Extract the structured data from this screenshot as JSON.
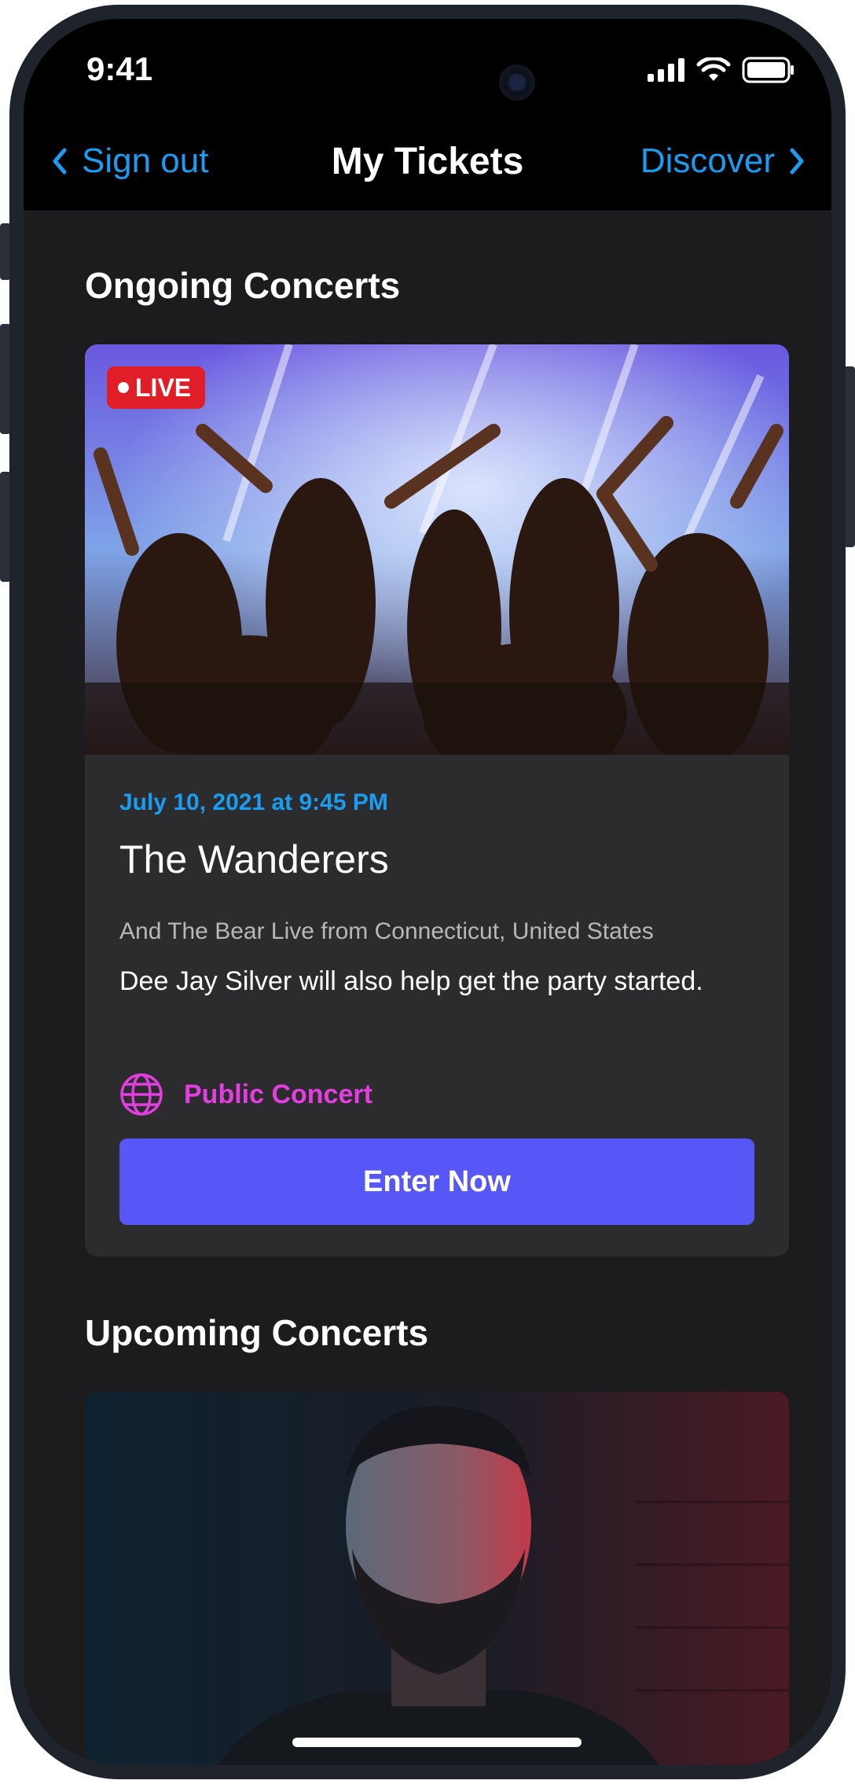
{
  "status_bar": {
    "time": "9:41",
    "icons": [
      "signal-icon",
      "wifi-icon",
      "battery-icon"
    ]
  },
  "nav": {
    "back_label": "Sign out",
    "title": "My Tickets",
    "forward_label": "Discover"
  },
  "ongoing": {
    "title": "Ongoing Concerts",
    "card": {
      "badge": "LIVE",
      "image": "concert-crowd-photo",
      "date": "July 10, 2021 at 9:45 PM",
      "name": "The Wanderers",
      "subtitle": "And The Bear Live from Connecticut, United States",
      "description": "Dee Jay Silver will also help get the party started.",
      "access_icon": "globe-icon",
      "access_label": "Public Concert",
      "button_label": "Enter Now"
    }
  },
  "upcoming": {
    "title": "Upcoming Concerts",
    "card": {
      "image": "artist-portrait-photo"
    }
  },
  "colors": {
    "accent_blue": "#1a9cf0",
    "button_purple": "#5757f8",
    "live_red": "#e01e28",
    "public_magenta": "#e33ee0",
    "background": "#1c1c1e",
    "card": "#2c2c2e"
  }
}
